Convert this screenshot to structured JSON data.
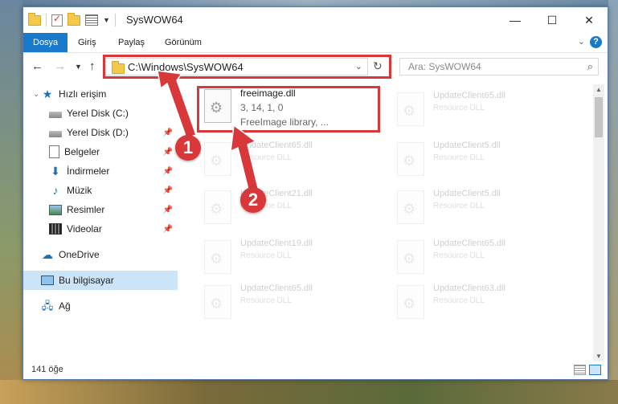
{
  "window": {
    "title": "SysWOW64",
    "buttons": {
      "minimize": "—",
      "maximize": "☐",
      "close": "✕"
    }
  },
  "ribbon": {
    "tabs": [
      "Dosya",
      "Giriş",
      "Paylaş",
      "Görünüm"
    ],
    "help": "?"
  },
  "nav": {
    "address": "C:\\Windows\\SysWOW64",
    "search_placeholder": "Ara: SysWOW64"
  },
  "sidebar": {
    "quick_access": "Hızlı erişim",
    "items": [
      {
        "label": "Yerel Disk (C:)",
        "icon": "disk-icon"
      },
      {
        "label": "Yerel Disk (D:)",
        "icon": "disk-icon"
      },
      {
        "label": "Belgeler",
        "icon": "document-icon"
      },
      {
        "label": "İndirmeler",
        "icon": "download-icon"
      },
      {
        "label": "Müzik",
        "icon": "music-icon"
      },
      {
        "label": "Resimler",
        "icon": "pictures-icon"
      },
      {
        "label": "Videolar",
        "icon": "video-icon"
      }
    ],
    "onedrive": "OneDrive",
    "this_pc": "Bu bilgisayar",
    "network": "Ağ"
  },
  "files": {
    "highlighted": {
      "name": "freeimage.dll",
      "version": "3, 14, 1, 0",
      "description": "FreeImage library, ..."
    },
    "background": [
      {
        "name": "UpdateClient65.dll",
        "desc": "Resource DLL"
      },
      {
        "name": "UpdateClient65.dll",
        "desc": "Resource DLL"
      },
      {
        "name": "UpdateClient5.dll",
        "desc": "Resource DLL"
      },
      {
        "name": "UpdateClient21.dll",
        "desc": "Resource DLL"
      },
      {
        "name": "UpdateClient5.dll",
        "desc": "Resource DLL"
      },
      {
        "name": "UpdateClient19.dll",
        "desc": "Resource DLL"
      },
      {
        "name": "UpdateClient65.dll",
        "desc": "Resource DLL"
      },
      {
        "name": "UpdateClient65.dll",
        "desc": "Resource DLL"
      },
      {
        "name": "UpdateClient63.dll",
        "desc": "Resource DLL"
      }
    ]
  },
  "status": {
    "count": "141 öğe"
  },
  "callouts": {
    "one": "1",
    "two": "2"
  },
  "colors": {
    "accent": "#1979ca",
    "highlight": "#d9383a",
    "selection": "#cce4f7"
  }
}
